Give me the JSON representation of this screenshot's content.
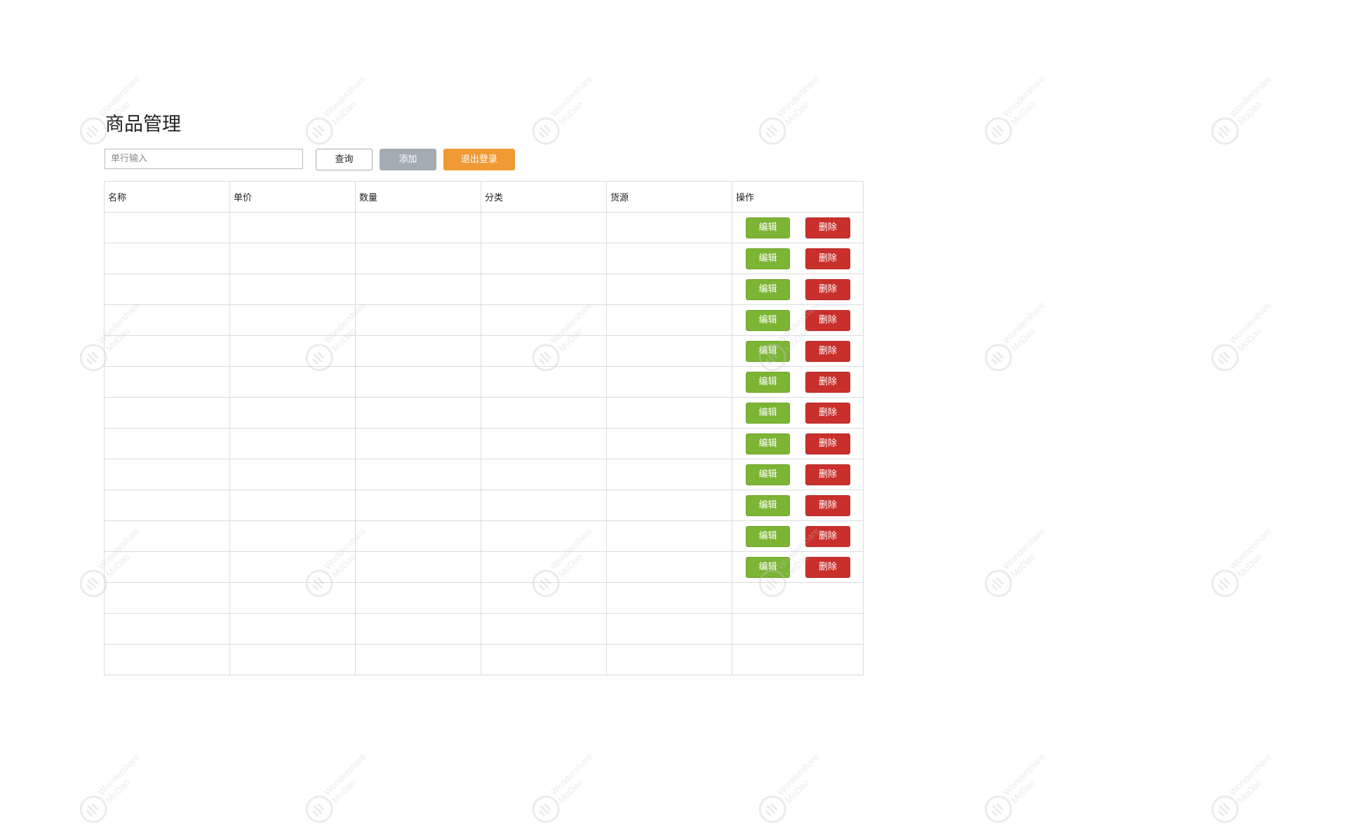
{
  "page": {
    "title": "商品管理"
  },
  "toolbar": {
    "search_placeholder": "单行输入",
    "search_value": "",
    "query_label": "查询",
    "add_label": "添加",
    "logout_label": "退出登录"
  },
  "colors": {
    "edit_button": "#7cb434",
    "delete_button": "#c9302c",
    "add_button": "#a3acb4",
    "logout_button": "#f09a35",
    "border": "#dcdcdc"
  },
  "table": {
    "columns": [
      "名称",
      "单价",
      "数量",
      "分类",
      "货源",
      "操作"
    ],
    "rows": [
      {
        "actions": true
      },
      {
        "actions": true
      },
      {
        "actions": true
      },
      {
        "actions": true
      },
      {
        "actions": true
      },
      {
        "actions": true
      },
      {
        "actions": true
      },
      {
        "actions": true
      },
      {
        "actions": true
      },
      {
        "actions": true
      },
      {
        "actions": true
      },
      {
        "actions": true
      },
      {
        "actions": false
      },
      {
        "actions": false
      },
      {
        "actions": false
      }
    ],
    "edit_label": "编辑",
    "delete_label": "删除"
  },
  "watermark": {
    "text_line1": "Wondershare",
    "text_line2": "MoDao",
    "icon": "modao-logo-icon"
  }
}
